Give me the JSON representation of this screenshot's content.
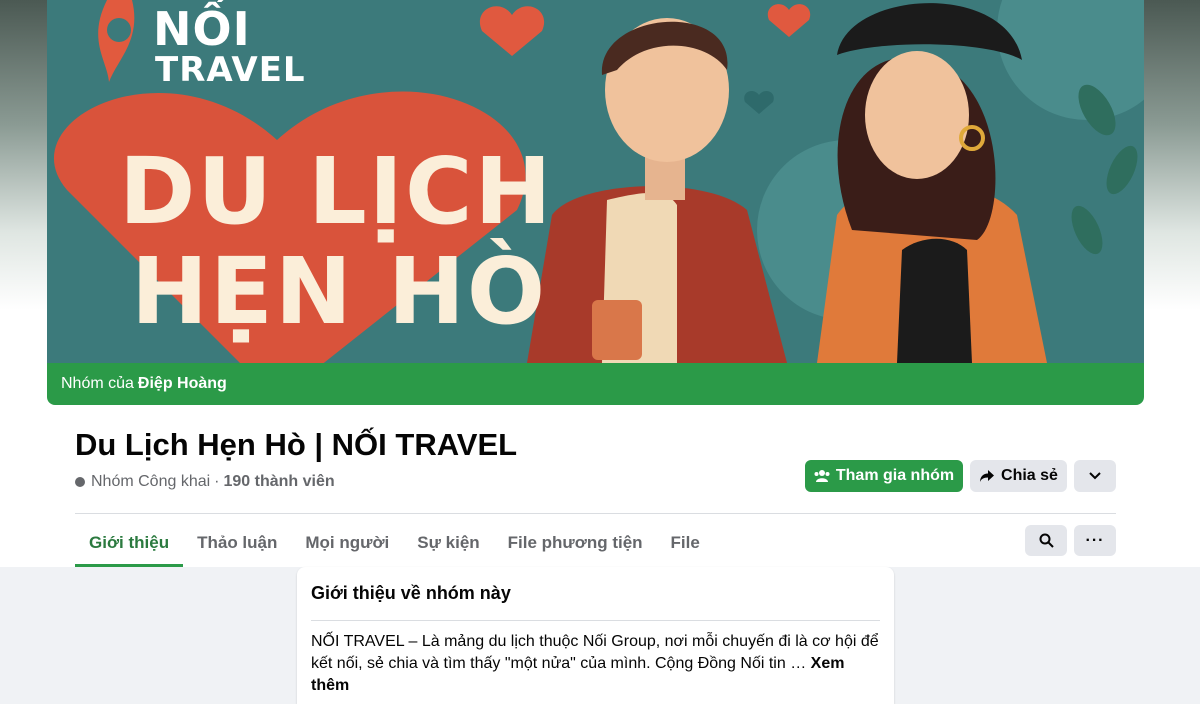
{
  "cover": {
    "brand_line1": "NỐI",
    "brand_line2": "TRAVEL",
    "headline_line1": "DU LỊCH",
    "headline_line2": "HẸN HÒ",
    "owner_prefix": "Nhóm của",
    "owner_name": "Điệp Hoàng",
    "colors": {
      "teal_bg": "#3c7a7b",
      "heart_red": "#d9533b",
      "strip_green": "#2b9a48"
    }
  },
  "group": {
    "title": "Du Lịch Hẹn Hò | NỐI TRAVEL",
    "privacy": "Nhóm Công khai",
    "separator": "·",
    "members": "190 thành viên"
  },
  "actions": {
    "join_label": "Tham gia nhóm",
    "share_label": "Chia sẻ",
    "more_icon": "chevron-down-icon",
    "search_icon": "search-icon",
    "dots_label": "···"
  },
  "tabs": [
    {
      "label": "Giới thiệu",
      "active": true
    },
    {
      "label": "Thảo luận",
      "active": false
    },
    {
      "label": "Mọi người",
      "active": false
    },
    {
      "label": "Sự kiện",
      "active": false
    },
    {
      "label": "File phương tiện",
      "active": false
    },
    {
      "label": "File",
      "active": false
    }
  ],
  "about": {
    "title": "Giới thiệu về nhóm này",
    "text": "NỐI TRAVEL – Là mảng du lịch thuộc Nối Group, nơi mỗi chuyến đi là cơ hội để kết nối, sẻ chia và tìm thấy \"một nửa\" của mình. Cộng Đồng Nối tin … ",
    "see_more": "Xem thêm"
  }
}
